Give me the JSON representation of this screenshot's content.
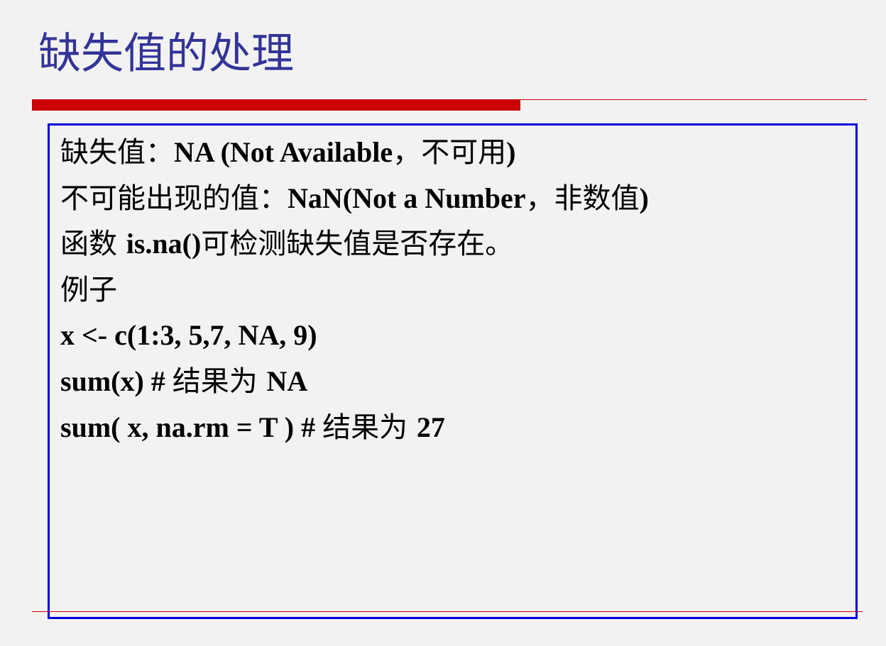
{
  "slide": {
    "title": "缺失值的处理"
  },
  "content": {
    "lines": [
      [
        {
          "text": "缺失值：",
          "latin": false
        },
        {
          "text": "NA (Not Available",
          "latin": true
        },
        {
          "text": "，不可用",
          "latin": false
        },
        {
          "text": ")",
          "latin": true
        }
      ],
      [
        {
          "text": "不可能出现的值：",
          "latin": false
        },
        {
          "text": "NaN(Not a Number",
          "latin": true
        },
        {
          "text": "，非数值",
          "latin": false
        },
        {
          "text": ")",
          "latin": true
        }
      ],
      [
        {
          "text": "函数 ",
          "latin": false
        },
        {
          "text": "is.na()",
          "latin": true
        },
        {
          "text": "可检测缺失值是否存在。",
          "latin": false
        }
      ],
      [
        {
          "text": "例子",
          "latin": false
        }
      ],
      [
        {
          "text": "x <- c(1:3, 5,7, NA, 9)",
          "latin": true
        }
      ],
      [
        {
          "text": "sum(x) #  ",
          "latin": true
        },
        {
          "text": "结果为 ",
          "latin": false
        },
        {
          "text": "NA",
          "latin": true
        }
      ],
      [
        {
          "text": "sum( x, na.rm = T ) #  ",
          "latin": true
        },
        {
          "text": "结果为 ",
          "latin": false
        },
        {
          "text": "27",
          "latin": true
        }
      ]
    ]
  }
}
